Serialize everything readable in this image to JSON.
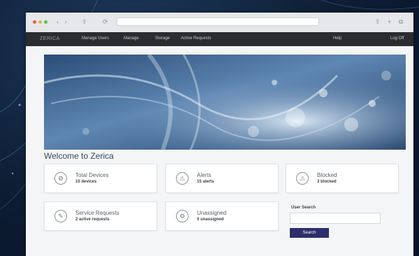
{
  "browser": {
    "url": "",
    "back": "‹",
    "forward": "›",
    "reload": "⟳",
    "share": "⇪",
    "plus": "+",
    "tabs": "⧉"
  },
  "header": {
    "brand": "ZERICA",
    "menu": [
      "Manage Users",
      "Manage",
      "Storage",
      "Active Requests"
    ],
    "right_link": "Help",
    "logout": "Log Off"
  },
  "welcome": "Welcome to Zerica",
  "cards": [
    {
      "title": "Total Devices",
      "sub": "10 devices",
      "icon": "devices-icon",
      "glyph": "⚙"
    },
    {
      "title": "Alerts",
      "sub": "15 alerts",
      "icon": "alert-icon",
      "glyph": "⚠"
    },
    {
      "title": "Blocked",
      "sub": "3 blocked",
      "icon": "blocked-icon",
      "glyph": "⚠"
    },
    {
      "title": "Service Requests",
      "sub": "2 active requests",
      "icon": "wrench-icon",
      "glyph": "✎"
    },
    {
      "title": "Unassigned",
      "sub": "0 unassigned",
      "icon": "unassigned-icon",
      "glyph": "⚙"
    }
  ],
  "search": {
    "label": "User Search",
    "placeholder": "",
    "button": "Search"
  },
  "colors": {
    "header_bg": "#2b2c30",
    "accent_button": "#2c2f6b",
    "welcome_text": "#34495e"
  }
}
